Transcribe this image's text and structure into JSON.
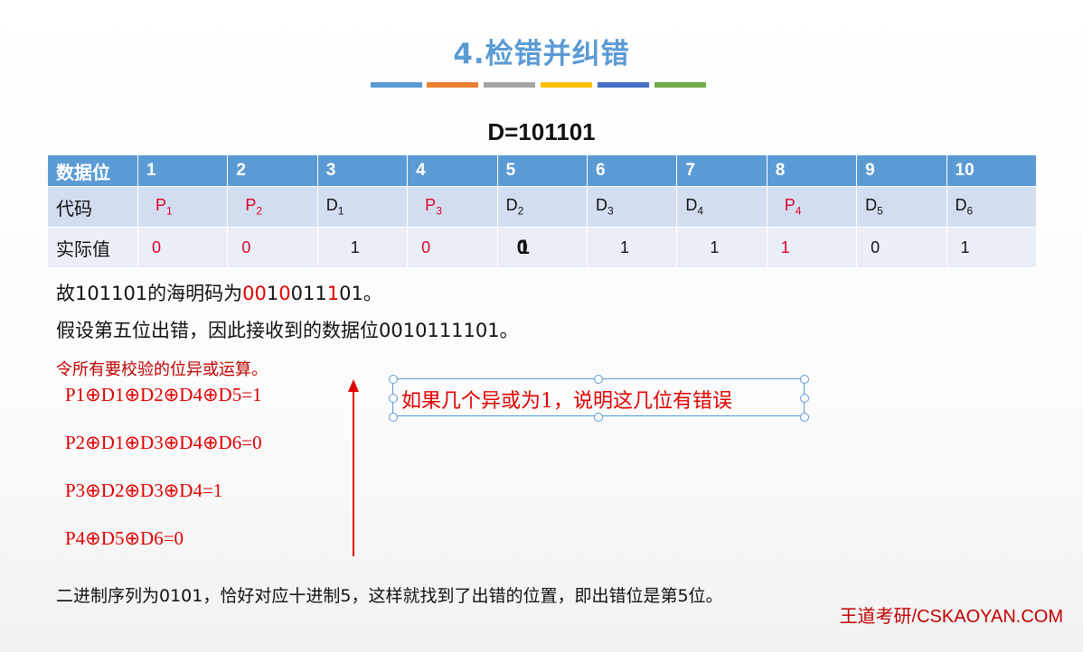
{
  "slide": {
    "title": "4.检错并纠错",
    "accent_colors": [
      "#5b9bd5",
      "#ed7d31",
      "#a5a5a5",
      "#ffc000",
      "#4472c4",
      "#70ad47"
    ],
    "heading": "D=101101"
  },
  "table": {
    "header": [
      "数据位",
      "1",
      "2",
      "3",
      "4",
      "5",
      "6",
      "7",
      "8",
      "9",
      "10"
    ],
    "code_label": "代码",
    "codes": [
      {
        "base": "P",
        "sub": "1",
        "parity": true
      },
      {
        "base": "P",
        "sub": "2",
        "parity": true
      },
      {
        "base": "D",
        "sub": "1",
        "parity": false
      },
      {
        "base": "P",
        "sub": "3",
        "parity": true
      },
      {
        "base": "D",
        "sub": "2",
        "parity": false
      },
      {
        "base": "D",
        "sub": "3",
        "parity": false
      },
      {
        "base": "D",
        "sub": "4",
        "parity": false
      },
      {
        "base": "P",
        "sub": "4",
        "parity": true
      },
      {
        "base": "D",
        "sub": "5",
        "parity": false
      },
      {
        "base": "D",
        "sub": "6",
        "parity": false
      }
    ],
    "value_label": "实际值",
    "values": [
      "0",
      "0",
      "1",
      "0",
      "1",
      "1",
      "1",
      "1",
      "0",
      "1"
    ],
    "pos5_overlap": [
      "0",
      "1"
    ]
  },
  "text": {
    "line1_prefix": "故101101的海明码为",
    "line1_code_parts": [
      {
        "t": "00",
        "red": true
      },
      {
        "t": "1",
        "red": false
      },
      {
        "t": "0",
        "red": true
      },
      {
        "t": "011",
        "red": false
      },
      {
        "t": "1",
        "red": true
      },
      {
        "t": "01",
        "red": false
      }
    ],
    "line1_suffix": "。",
    "line2": "假设第五位出错，因此接收到的数据位0010111101。",
    "instruction": "令所有要校验的位异或运算。",
    "equations": [
      "P1⊕D1⊕D2⊕D4⊕D5=1",
      "P2⊕D1⊕D3⊕D4⊕D6=0",
      "P3⊕D2⊕D3⊕D4=1",
      "P4⊕D5⊕D6=0"
    ],
    "callout": "如果几个异或为1，说明这几位有错误",
    "bottom": "二进制序列为0101，恰好对应十进制5，这样就找到了出错的位置，即出错位是第5位。",
    "footer": "王道考研/CSKAOYAN.COM"
  }
}
